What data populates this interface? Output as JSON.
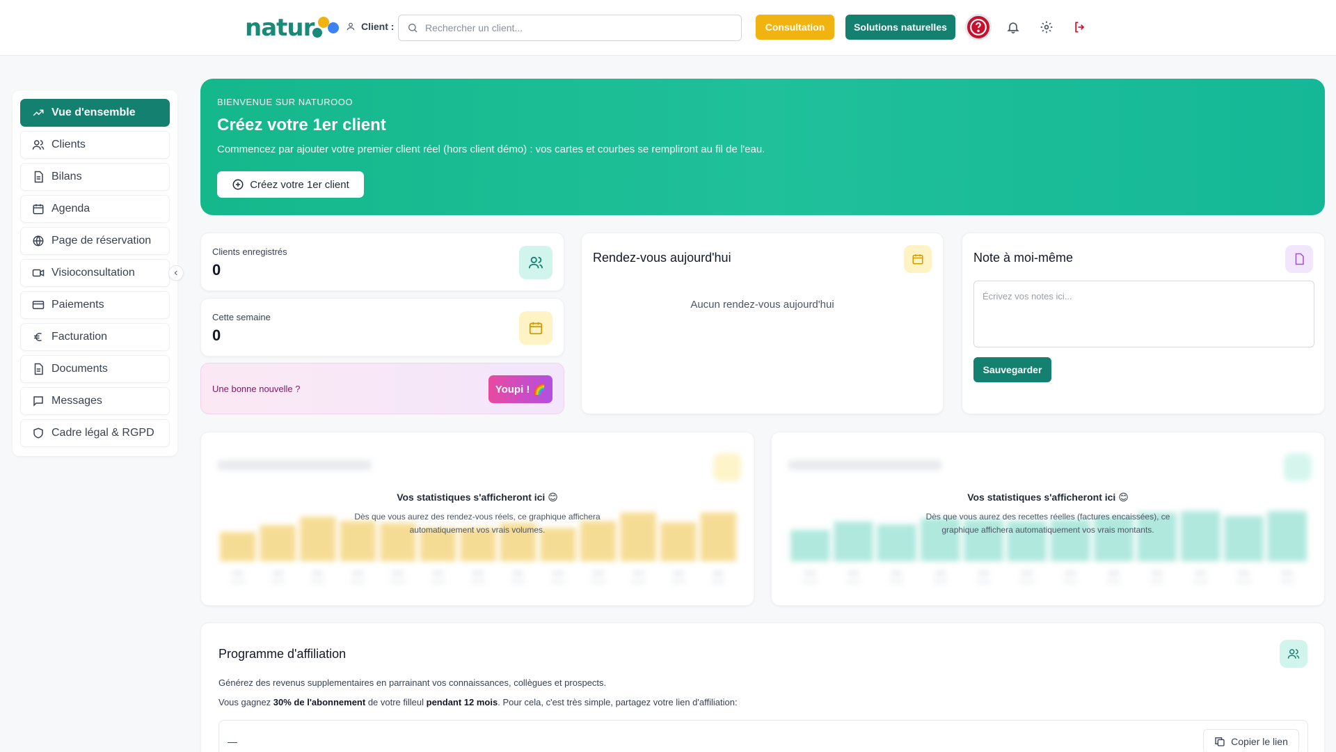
{
  "header": {
    "logo_text": "natur",
    "client_label": "Client :",
    "search_placeholder": "Rechercher un client...",
    "consultation_label": "Consultation",
    "solutions_label": "Solutions naturelles",
    "colors": {
      "brand": "#14806f",
      "consult": "#f0b30f",
      "help": "#c8102e"
    }
  },
  "sidebar": {
    "items": [
      {
        "label": "Vue d'ensemble",
        "icon": "trending-up-icon",
        "active": true
      },
      {
        "label": "Clients",
        "icon": "users-icon"
      },
      {
        "label": "Bilans",
        "icon": "document-icon"
      },
      {
        "label": "Agenda",
        "icon": "calendar-icon"
      },
      {
        "label": "Page de réservation",
        "icon": "globe-icon"
      },
      {
        "label": "Visioconsultation",
        "icon": "video-icon"
      },
      {
        "label": "Paiements",
        "icon": "credit-card-icon"
      },
      {
        "label": "Facturation",
        "icon": "euro-icon"
      },
      {
        "label": "Documents",
        "icon": "file-icon"
      },
      {
        "label": "Messages",
        "icon": "message-icon"
      },
      {
        "label": "Cadre légal & RGPD",
        "icon": "shield-icon"
      }
    ]
  },
  "banner": {
    "kicker": "BIENVENUE SUR NATUROOO",
    "title": "Créez votre 1er client",
    "text": "Commencez par ajouter votre premier client réel (hors client démo) : vos cartes et courbes se rempliront au fil de l'eau.",
    "button_label": "Créez votre 1er client"
  },
  "stats": {
    "clients": {
      "label": "Clients enregistrés",
      "value": "0"
    },
    "week": {
      "label": "Cette semaine",
      "value": "0"
    }
  },
  "good_news": {
    "label": "Une bonne nouvelle ?",
    "button_label": "Youpi ! 🌈"
  },
  "appointments": {
    "title": "Rendez-vous aujourd'hui",
    "empty_text": "Aucun rendez-vous aujourd'hui"
  },
  "note": {
    "title": "Note à moi-même",
    "placeholder": "Écrivez vos notes ici...",
    "save_label": "Sauvegarder"
  },
  "charts": {
    "left": {
      "overlay_title": "Vos statistiques s'afficheront ici 😊",
      "overlay_text": "Dès que vous aurez des rendez-vous réels, ce graphique affichera automatiquement vos vrais volumes.",
      "bar_color": "#f5d98a",
      "values": [
        42,
        52,
        64,
        58,
        55,
        48,
        48,
        55,
        48,
        58,
        70,
        56,
        70
      ]
    },
    "right": {
      "overlay_title": "Vos statistiques s'afficheront ici 😊",
      "overlay_text": "Dès que vous aurez des recettes réelles (factures encaissées), ce graphique affichera automatiquement vos vrais montants.",
      "bar_color": "#a8e6da",
      "values": [
        45,
        57,
        53,
        62,
        60,
        58,
        60,
        64,
        70,
        72,
        65,
        72
      ]
    }
  },
  "affiliation": {
    "title": "Programme d'affiliation",
    "text1": "Générez des revenus supplementaires en parrainant vos connaissances, collègues et prospects.",
    "text2_a": "Vous gagnez ",
    "text2_b": "30% de l'abonnement",
    "text2_c": " de votre filleul ",
    "text2_d": "pendant 12 mois",
    "text2_e": ". Pour cela, c'est très simple, partagez votre lien d'affiliation:",
    "link_value": "—",
    "copy_label": "Copier le lien"
  }
}
